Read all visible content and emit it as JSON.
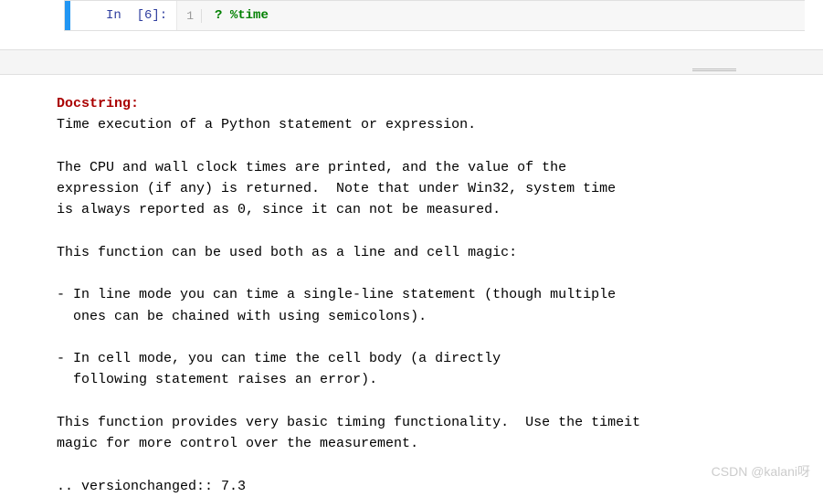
{
  "cell": {
    "prompt": "In  [6]:",
    "line_number": "1",
    "code_question": "?",
    "code_magic": "%time"
  },
  "docstring": {
    "label": "Docstring:",
    "body": "Time execution of a Python statement or expression.\n\nThe CPU and wall clock times are printed, and the value of the\nexpression (if any) is returned.  Note that under Win32, system time\nis always reported as 0, since it can not be measured.\n\nThis function can be used both as a line and cell magic:\n\n- In line mode you can time a single-line statement (though multiple\n  ones can be chained with using semicolons).\n\n- In cell mode, you can time the cell body (a directly\n  following statement raises an error).\n\nThis function provides very basic timing functionality.  Use the timeit\nmagic for more control over the measurement.\n\n.. versionchanged:: 7.3"
  },
  "watermark": "CSDN @kalani呀"
}
